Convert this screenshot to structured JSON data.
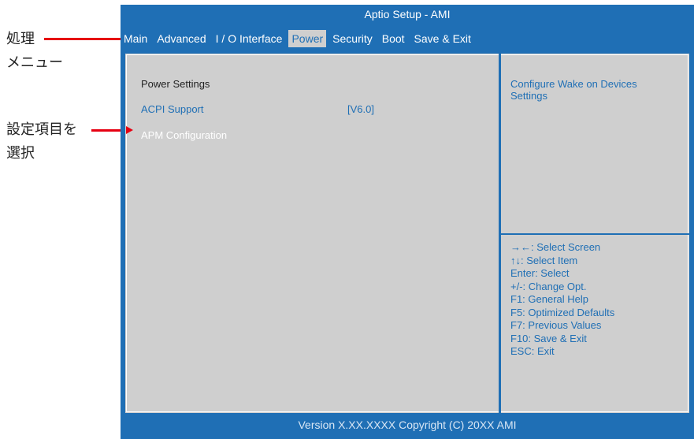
{
  "annotations": {
    "menu_label_line1": "処理",
    "menu_label_line2": "メニュー",
    "select_label_line1": "設定項目を",
    "select_label_line2": "選択"
  },
  "bios": {
    "title": "Aptio Setup - AMI",
    "menus": [
      {
        "label": "Main"
      },
      {
        "label": "Advanced"
      },
      {
        "label": "I / O Interface"
      },
      {
        "label": "Power"
      },
      {
        "label": "Security"
      },
      {
        "label": "Boot"
      },
      {
        "label": "Save & Exit"
      }
    ],
    "active_menu": "Power",
    "left_pane": {
      "section_title": "Power Settings",
      "acpi_label": "ACPI Support",
      "acpi_value": "[V6.0]",
      "apm_label": "APM Configuration"
    },
    "right_pane": {
      "description": "Configure Wake on Devices Settings",
      "help": [
        "→←: Select Screen",
        "↑↓: Select Item",
        "Enter: Select",
        "+/-: Change Opt.",
        "F1: General Help",
        "F5: Optimized Defaults",
        "F7: Previous Values",
        "F10: Save & Exit",
        "ESC: Exit"
      ]
    },
    "footer": "Version X.XX.XXXX Copyright (C) 20XX AMI",
    "colors": {
      "frame": "#1f6fb5",
      "panel": "#cfcfcf",
      "annotation": "#e60012"
    }
  }
}
